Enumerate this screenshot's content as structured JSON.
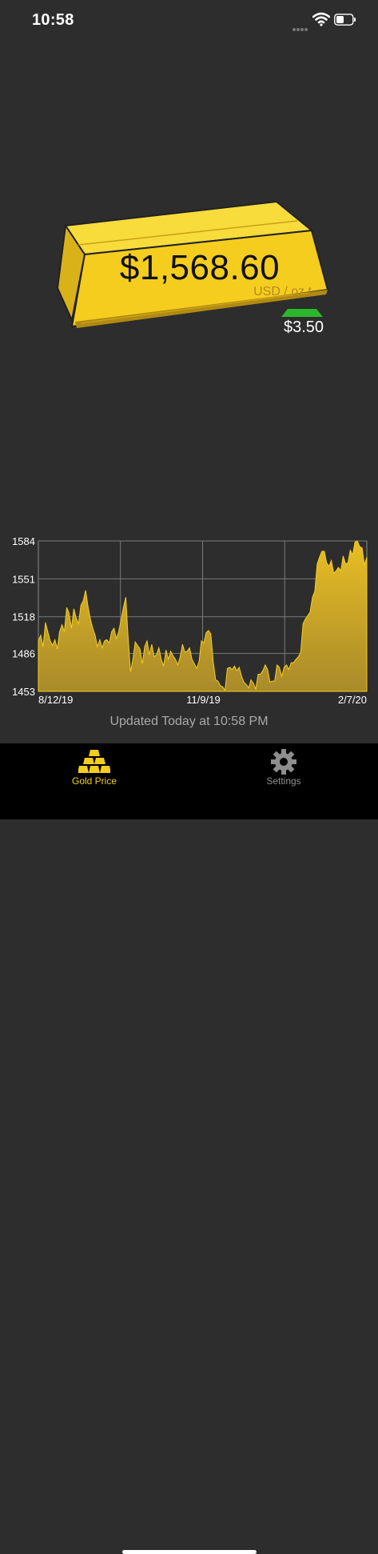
{
  "status": {
    "time": "10:58"
  },
  "price": {
    "value": "$1,568.60",
    "unit": "USD / oz t",
    "change": "$3.50",
    "direction": "up"
  },
  "colors": {
    "gold": "#f5cd1f",
    "up_green": "#2ab82a",
    "background": "#2d2d2d"
  },
  "chart_data": {
    "type": "area",
    "x_tick_labels": [
      "8/12/19",
      "11/9/19",
      "2/7/20"
    ],
    "y_tick_labels": [
      1584,
      1551,
      1518,
      1486,
      1453
    ],
    "ylim": [
      1453,
      1584
    ],
    "grid": true,
    "series": [
      {
        "values": [
          1497,
          1502,
          1492,
          1513,
          1505,
          1497,
          1493,
          1498,
          1490,
          1505,
          1511,
          1505,
          1526,
          1521,
          1508,
          1525,
          1517,
          1512,
          1528,
          1532,
          1541,
          1527,
          1516,
          1508,
          1502,
          1492,
          1498,
          1491,
          1497,
          1498,
          1495,
          1505,
          1508,
          1499,
          1505,
          1515,
          1526,
          1535,
          1499,
          1470,
          1481,
          1496,
          1493,
          1490,
          1477,
          1492,
          1497,
          1485,
          1494,
          1483,
          1485,
          1491,
          1481,
          1475,
          1489,
          1481,
          1488,
          1484,
          1481,
          1476,
          1483,
          1494,
          1487,
          1488,
          1491,
          1481,
          1477,
          1473,
          1479,
          1497,
          1495,
          1504,
          1506,
          1503,
          1479,
          1463,
          1462,
          1458,
          1457,
          1454,
          1473,
          1474,
          1472,
          1475,
          1471,
          1474,
          1466,
          1461,
          1459,
          1456,
          1463,
          1460,
          1455,
          1468,
          1468,
          1471,
          1476,
          1472,
          1461,
          1462,
          1462,
          1476,
          1474,
          1466,
          1474,
          1476,
          1472,
          1478,
          1478,
          1481,
          1483,
          1487,
          1512,
          1516,
          1519,
          1522,
          1535,
          1540,
          1564,
          1570,
          1575,
          1575,
          1565,
          1562,
          1567,
          1556,
          1558,
          1561,
          1558,
          1571,
          1564,
          1565,
          1576,
          1572,
          1583,
          1584,
          1579,
          1578,
          1563,
          1570
        ]
      }
    ]
  },
  "updated": "Updated Today at 10:58 PM",
  "tabs": [
    {
      "label": "Gold Price",
      "icon": "gold-bars-icon",
      "active": true
    },
    {
      "label": "Settings",
      "icon": "gear-icon",
      "active": false
    }
  ]
}
